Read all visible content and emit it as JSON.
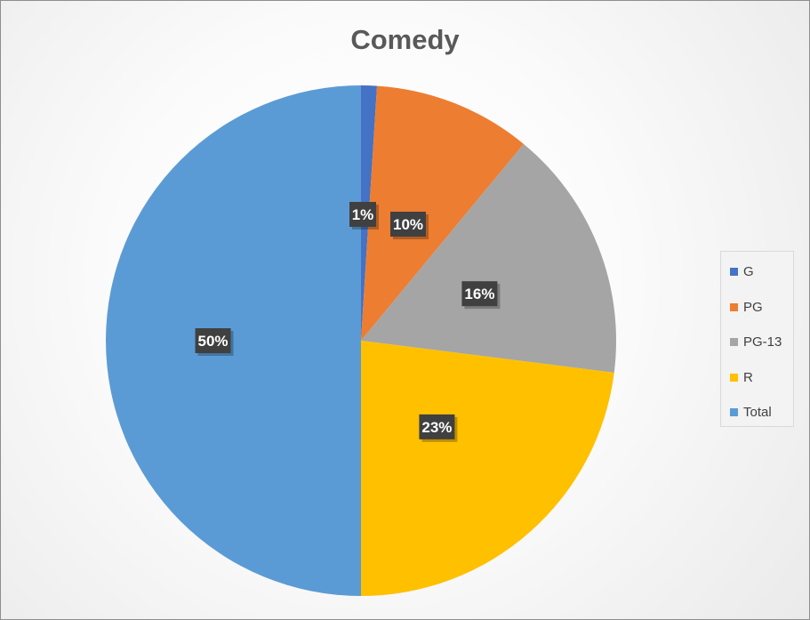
{
  "chart_data": {
    "type": "pie",
    "title": "Comedy",
    "categories": [
      "G",
      "PG",
      "PG-13",
      "R",
      "Total"
    ],
    "values": [
      1,
      10,
      16,
      23,
      50
    ],
    "data_labels": [
      "1%",
      "10%",
      "16%",
      "23%",
      "50%"
    ],
    "colors": [
      "#4472c4",
      "#ed7d31",
      "#a5a5a5",
      "#ffc000",
      "#5b9bd5"
    ],
    "legend_position": "right"
  }
}
